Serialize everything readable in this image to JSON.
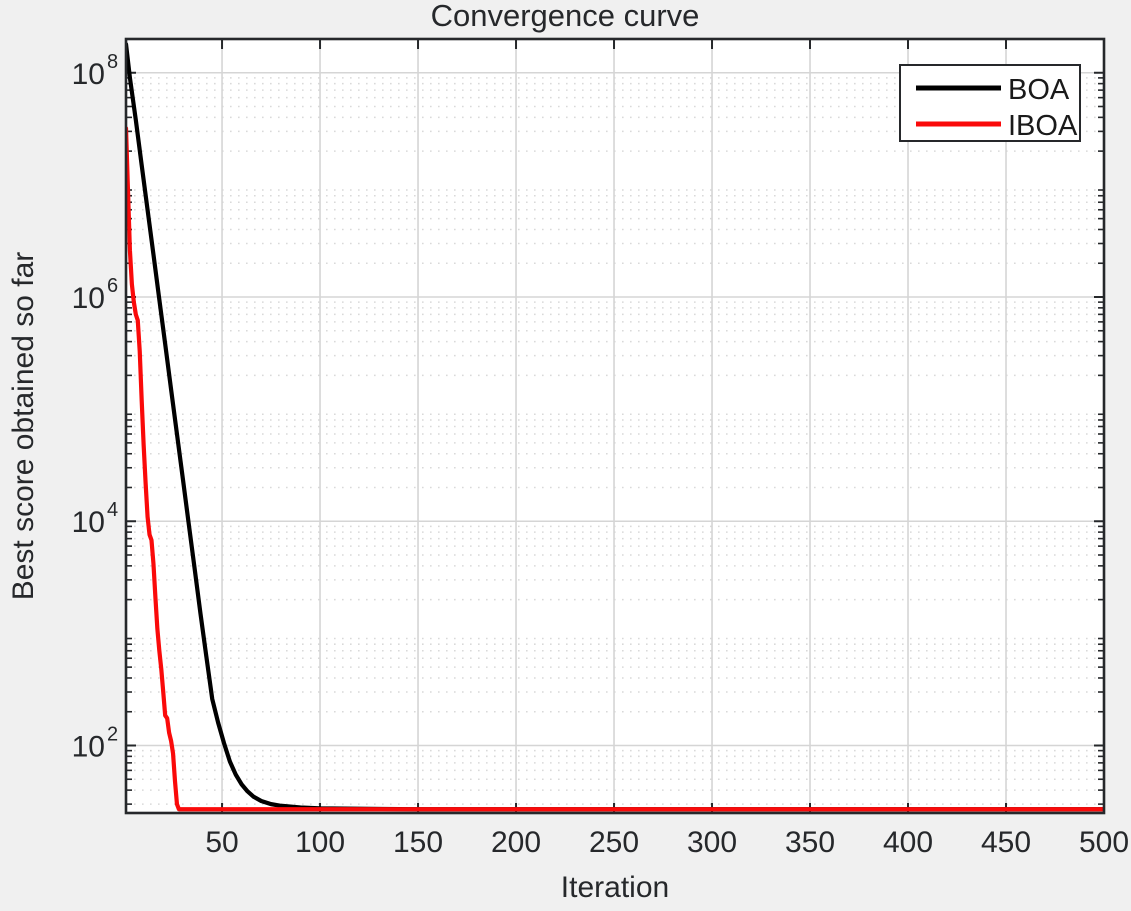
{
  "figure": {
    "title": "Convergence curve",
    "background_color": "#f0f0f0",
    "plot_background_color": "#ffffff",
    "axis_color": "#26282b",
    "grid_color": "#d5d5d5",
    "minor_grid_color": "#d9d9d9"
  },
  "axes": {
    "x_label": "Iteration",
    "y_label": "Best score obtained so far",
    "x_ticks": [
      "50",
      "100",
      "150",
      "200",
      "250",
      "300",
      "350",
      "400",
      "450",
      "500"
    ],
    "y_ticks": [
      {
        "base": "10",
        "exp": "8"
      },
      {
        "base": "10",
        "exp": "6"
      },
      {
        "base": "10",
        "exp": "4"
      },
      {
        "base": "10",
        "exp": "2"
      }
    ]
  },
  "legend": {
    "entries": [
      {
        "label": "BOA",
        "color": "#000000"
      },
      {
        "label": "IBOA",
        "color": "#fa0a0a"
      }
    ]
  },
  "chart_data": {
    "type": "line",
    "title": "Convergence curve",
    "xlabel": "Iteration",
    "ylabel": "Best score obtained so far",
    "yscale": "log",
    "xlim": [
      1,
      500
    ],
    "ylim": [
      25,
      200000000
    ],
    "xticks": [
      50,
      100,
      150,
      200,
      250,
      300,
      350,
      400,
      450,
      500
    ],
    "yticks": [
      100,
      10000,
      1000000,
      100000000
    ],
    "grid": true,
    "legend_position": "top-right",
    "series": [
      {
        "name": "BOA",
        "color": "#000000",
        "x": [
          1,
          3,
          6,
          9,
          12,
          15,
          18,
          21,
          24,
          27,
          30,
          33,
          36,
          39,
          42,
          45,
          48,
          51,
          54,
          57,
          60,
          63,
          66,
          70,
          75,
          80,
          90,
          100,
          150,
          200,
          250,
          300,
          350,
          400,
          450,
          500
        ],
        "y": [
          180000000,
          90000000,
          38000000,
          15000000,
          6000000,
          2400000,
          950000,
          380000,
          150000,
          60000,
          24000,
          9500,
          3800,
          1500,
          620,
          260,
          160,
          105,
          72,
          55,
          45,
          39,
          35,
          32,
          30,
          29,
          28,
          27.5,
          27,
          27,
          27,
          27,
          27,
          27,
          27,
          27
        ]
      },
      {
        "name": "IBOA",
        "color": "#fa0a0a",
        "x": [
          1,
          2,
          3,
          4,
          5,
          6,
          7,
          8,
          9,
          10,
          11,
          12,
          13,
          14,
          15,
          16,
          17,
          18,
          19,
          20,
          21,
          22,
          23,
          24,
          25,
          26,
          27,
          28,
          30,
          40,
          60,
          100,
          200,
          300,
          400,
          500
        ],
        "y": [
          32000000,
          9000000,
          2600000,
          1300000,
          900000,
          700000,
          620000,
          330000,
          120000,
          48000,
          22000,
          11000,
          7600,
          6800,
          4200,
          2100,
          1100,
          700,
          480,
          300,
          185,
          175,
          130,
          110,
          85,
          48,
          30,
          27,
          27,
          27,
          27,
          27,
          27,
          27,
          27,
          27
        ]
      }
    ]
  }
}
